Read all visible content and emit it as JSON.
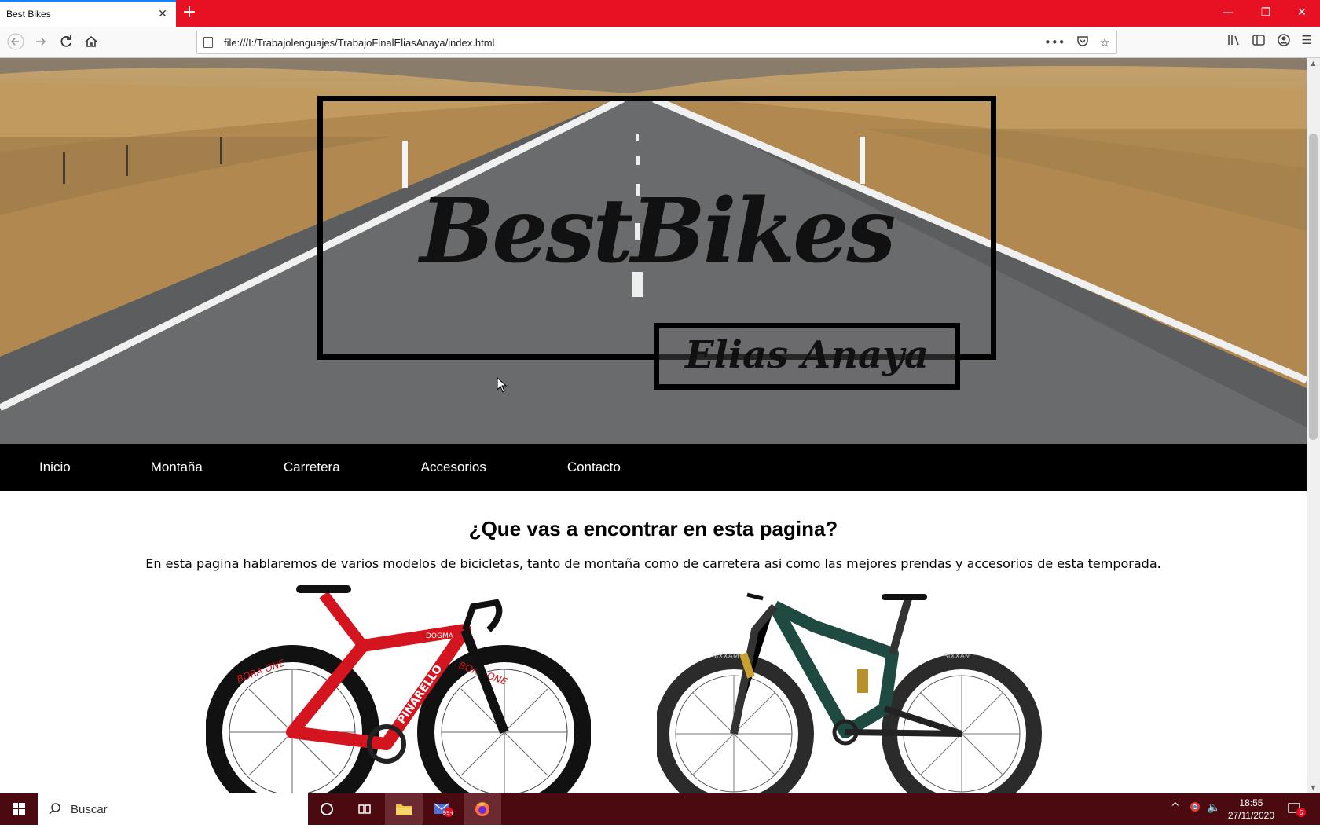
{
  "browser": {
    "tab_title": "Best Bikes",
    "tab_close": "✕",
    "new_tab": "+",
    "url": "file:///I:/Trabajolenguajes/TrabajoFinalEliasAnaya/index.html",
    "window_controls": {
      "minimize": "—",
      "restore": "❐",
      "close": "✕"
    }
  },
  "hero": {
    "logo": "BestBikes",
    "author": "Elias Anaya"
  },
  "menu": {
    "items": [
      {
        "label": "Inicio"
      },
      {
        "label": "Montaña"
      },
      {
        "label": "Carretera"
      },
      {
        "label": "Accesorios"
      },
      {
        "label": "Contacto"
      }
    ]
  },
  "intro": {
    "title": "¿Que vas a encontrar en esta pagina?",
    "text": "En esta pagina hablaremos de varios modelos de bicicletas, tanto de montaña como de carretera asi como las mejores prendas y accesorios de esta temporada."
  },
  "bikes": [
    {
      "kind": "road-bike",
      "frame_color": "#d4141e",
      "brand_text": "PINARELLO",
      "model_text": "DOGMA",
      "wheel_text": "BORA ONE"
    },
    {
      "kind": "mountain-bike",
      "frame_color": "#1f4a42",
      "brand_text": "SIXXAM",
      "model_text": "",
      "wheel_text": ""
    }
  ],
  "taskbar": {
    "search_placeholder": "Buscar",
    "time": "18:55",
    "date": "27/11/2020",
    "notifications": "6",
    "mail_badge": "99+"
  }
}
